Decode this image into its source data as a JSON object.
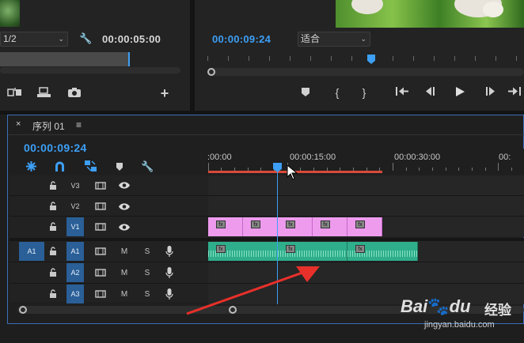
{
  "source_monitor": {
    "zoom_select": "1/2",
    "timecode": "00:00:05:00"
  },
  "program_monitor": {
    "timecode": "00:00:09:24",
    "fit_select": "适合"
  },
  "timeline": {
    "close_symbol": "×",
    "sequence_name": "序列 01",
    "menu_symbol": "≡",
    "playhead_timecode": "00:00:09:24",
    "ruler_labels": [
      ":00:00",
      "00:00:15:00",
      "00:00:30:00",
      "00:"
    ],
    "tracks": {
      "v3": "V3",
      "v2": "V2",
      "v1": "V1",
      "a1_source": "A1",
      "a1": "A1",
      "a2": "A2",
      "a3": "A3",
      "mute": "M",
      "solo": "S"
    },
    "video_clip_count": 5,
    "audio_clip_count": 3,
    "clip_fx_label": "fx"
  },
  "watermark": {
    "brand": "Bai",
    "brand2": "du",
    "brand_cn": "经验",
    "url": "jingyan.baidu.com"
  },
  "colors": {
    "accent_blue": "#3d9ff5",
    "target_blue": "#2a5f97",
    "video_clip": "#ee9bee",
    "audio_clip": "#2fae8b",
    "render_bar": "#d94a3a",
    "arrow": "#e8302a"
  },
  "icons": {
    "wrench": "wrench-icon",
    "lock": "lock-icon",
    "eye": "eye-icon",
    "mic": "microphone-icon",
    "play": "play-icon",
    "marker": "marker-icon",
    "camera": "camera-icon"
  }
}
